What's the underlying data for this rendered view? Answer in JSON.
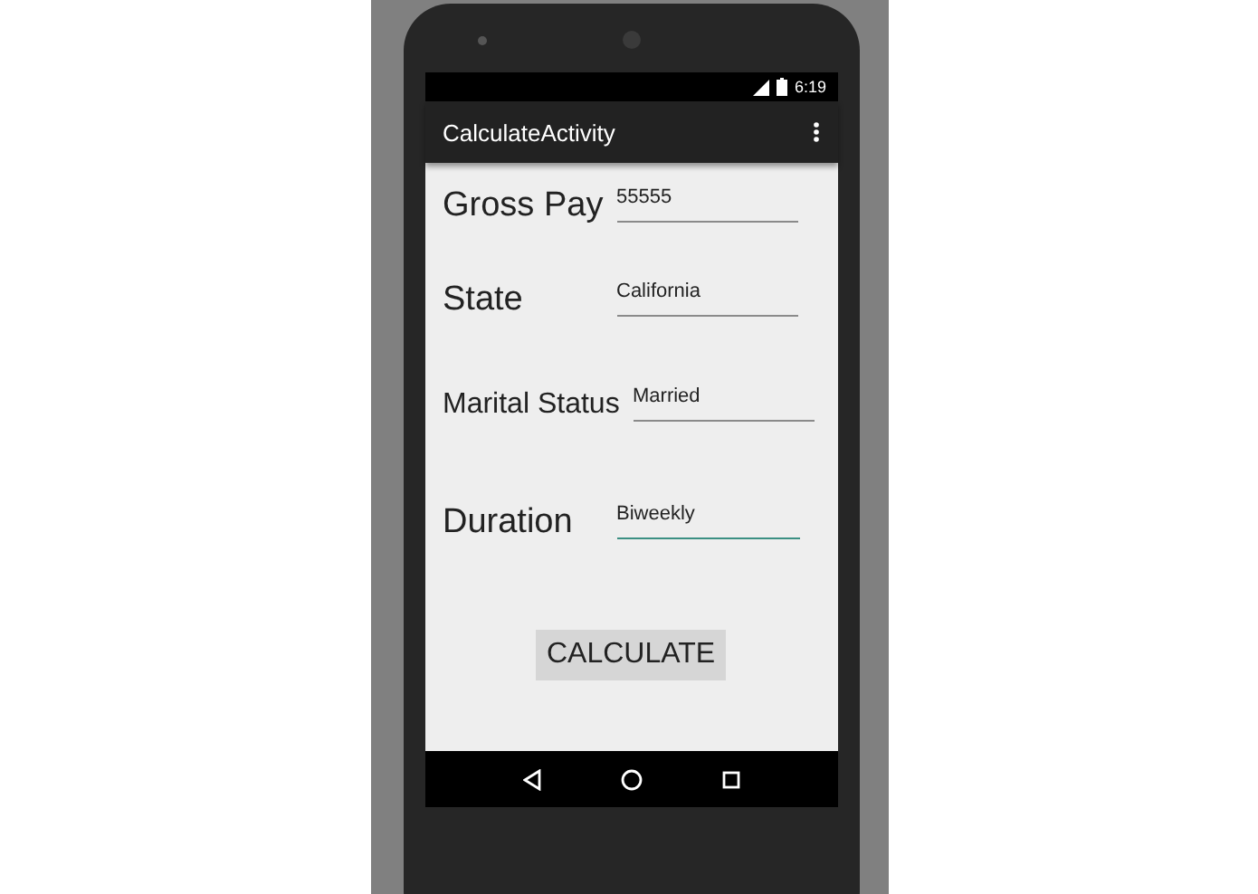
{
  "status_bar": {
    "time": "6:19"
  },
  "app_bar": {
    "title": "CalculateActivity"
  },
  "fields": [
    {
      "label": "Gross Pay",
      "value": "55555",
      "focused": false
    },
    {
      "label": "State",
      "value": "California",
      "focused": false
    },
    {
      "label": "Marital Status",
      "value": "Married",
      "focused": false
    },
    {
      "label": "Duration",
      "value": "Biweekly",
      "focused": true
    }
  ],
  "button": "CALCULATE"
}
